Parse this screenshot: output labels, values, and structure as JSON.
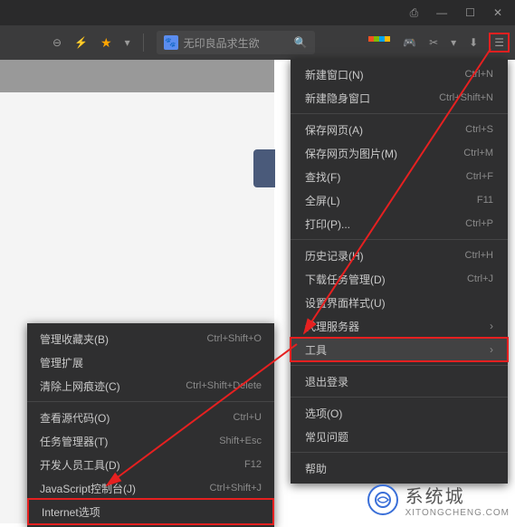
{
  "window": {
    "search_text": "无印良品求生欲"
  },
  "mainmenu": [
    {
      "label": "新建窗口(N)",
      "shortcut": "Ctrl+N"
    },
    {
      "label": "新建隐身窗口",
      "shortcut": "Ctrl+Shift+N"
    },
    {
      "sep": true
    },
    {
      "label": "保存网页(A)",
      "shortcut": "Ctrl+S"
    },
    {
      "label": "保存网页为图片(M)",
      "shortcut": "Ctrl+M"
    },
    {
      "label": "查找(F)",
      "shortcut": "Ctrl+F"
    },
    {
      "label": "全屏(L)",
      "shortcut": "F11"
    },
    {
      "label": "打印(P)...",
      "shortcut": "Ctrl+P"
    },
    {
      "sep": true
    },
    {
      "label": "历史记录(H)",
      "shortcut": "Ctrl+H"
    },
    {
      "label": "下载任务管理(D)",
      "shortcut": "Ctrl+J"
    },
    {
      "label": "设置界面样式(U)"
    },
    {
      "label": "代理服务器",
      "submenu": true
    },
    {
      "label": "工具",
      "submenu": true,
      "highlight": true
    },
    {
      "sep": true
    },
    {
      "label": "退出登录"
    },
    {
      "sep": true
    },
    {
      "label": "选项(O)"
    },
    {
      "label": "常见问题"
    },
    {
      "sep": true
    },
    {
      "label": "帮助"
    }
  ],
  "submenu": [
    {
      "label": "管理收藏夹(B)",
      "shortcut": "Ctrl+Shift+O"
    },
    {
      "label": "管理扩展"
    },
    {
      "label": "清除上网痕迹(C)",
      "shortcut": "Ctrl+Shift+Delete"
    },
    {
      "sep": true
    },
    {
      "label": "查看源代码(O)",
      "shortcut": "Ctrl+U"
    },
    {
      "label": "任务管理器(T)",
      "shortcut": "Shift+Esc"
    },
    {
      "label": "开发人员工具(D)",
      "shortcut": "F12"
    },
    {
      "label": "JavaScript控制台(J)",
      "shortcut": "Ctrl+Shift+J"
    },
    {
      "label": "Internet选项",
      "highlight": true
    }
  ],
  "watermark": {
    "title": "系统城",
    "url": "XITONGCHENG.COM"
  }
}
